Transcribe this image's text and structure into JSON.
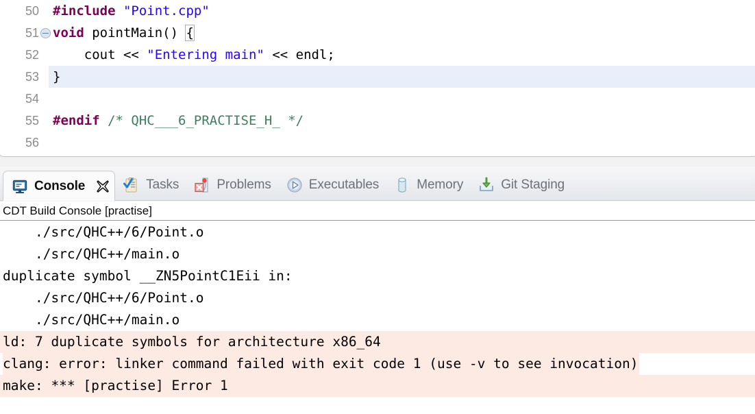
{
  "editor": {
    "lines": [
      {
        "num": "50",
        "fold": false,
        "highlight": false,
        "indent": 0,
        "tokens": [
          {
            "t": "pre",
            "s": "#include "
          },
          {
            "t": "str",
            "s": "\"Point.cpp\""
          }
        ]
      },
      {
        "num": "51",
        "fold": true,
        "highlight": false,
        "indent": 0,
        "tokens": [
          {
            "t": "kw",
            "s": "void"
          },
          {
            "t": "plain",
            "s": " pointMain() "
          },
          {
            "t": "brace",
            "s": "{"
          }
        ]
      },
      {
        "num": "52",
        "fold": false,
        "highlight": false,
        "indent": 0,
        "tokens": [
          {
            "t": "plain",
            "s": "    cout << "
          },
          {
            "t": "str",
            "s": "\"Entering main\""
          },
          {
            "t": "plain",
            "s": " << endl;"
          }
        ]
      },
      {
        "num": "53",
        "fold": false,
        "highlight": true,
        "indent": 0,
        "tokens": [
          {
            "t": "plain",
            "s": "}"
          }
        ]
      },
      {
        "num": "54",
        "fold": false,
        "highlight": false,
        "indent": 0,
        "tokens": []
      },
      {
        "num": "55",
        "fold": false,
        "highlight": false,
        "indent": 0,
        "tokens": [
          {
            "t": "pre",
            "s": "#endif"
          },
          {
            "t": "plain",
            "s": " "
          },
          {
            "t": "cmt",
            "s": "/* QHC___6_PRACTISE_H_ */"
          }
        ]
      },
      {
        "num": "56",
        "fold": false,
        "highlight": false,
        "indent": 0,
        "tokens": []
      }
    ]
  },
  "tabstrip": {
    "tabs": [
      {
        "label": "Console",
        "icon": "console-icon",
        "active": true,
        "closable": true
      },
      {
        "label": "Tasks",
        "icon": "tasks-icon",
        "active": false,
        "closable": false
      },
      {
        "label": "Problems",
        "icon": "problems-icon",
        "active": false,
        "closable": false
      },
      {
        "label": "Executables",
        "icon": "executables-icon",
        "active": false,
        "closable": false
      },
      {
        "label": "Memory",
        "icon": "memory-icon",
        "active": false,
        "closable": false
      },
      {
        "label": "Git Staging",
        "icon": "git-staging-icon",
        "active": false,
        "closable": false
      }
    ]
  },
  "console": {
    "header": "CDT Build Console [practise]",
    "lines": [
      {
        "text": "    ./src/QHC++/6/Point.o",
        "error": false,
        "full": false
      },
      {
        "text": "    ./src/QHC++/main.o",
        "error": false,
        "full": false
      },
      {
        "text": "duplicate symbol __ZN5PointC1Eii in:",
        "error": false,
        "full": false
      },
      {
        "text": "    ./src/QHC++/6/Point.o",
        "error": false,
        "full": false
      },
      {
        "text": "    ./src/QHC++/main.o",
        "error": false,
        "full": false
      },
      {
        "text": "ld: 7 duplicate symbols for architecture x86_64",
        "error": true,
        "full": true
      },
      {
        "text": "clang: error: linker command failed with exit code 1 (use -v to see invocation)",
        "error": true,
        "full": false
      },
      {
        "text": "make: *** [practise] Error 1",
        "error": true,
        "full": true
      }
    ]
  },
  "colors": {
    "preprocessor": "#7f0055",
    "keyword": "#7f0055",
    "string": "#2a00ff",
    "comment": "#3f7f5f",
    "error_background": "#fceae3",
    "line_highlight": "#e8effa",
    "line_number": "#8c8c8c"
  }
}
